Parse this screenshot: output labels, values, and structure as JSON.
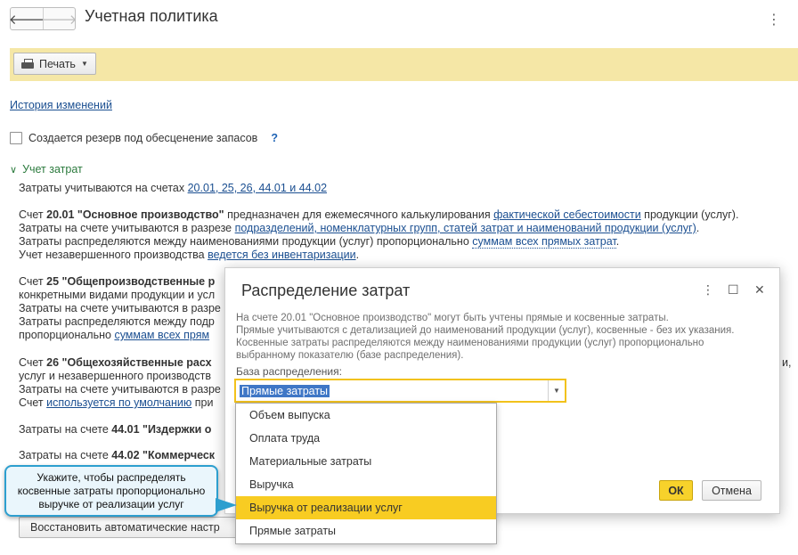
{
  "window": {
    "title": "Учетная политика",
    "back_glyph": "🡐",
    "forward_glyph": "🡒",
    "more_glyph": "⋮"
  },
  "toolbar": {
    "print_label": "Печать"
  },
  "history_link": "История изменений",
  "reserve_checkbox": {
    "label": "Создается резерв под обесценение запасов",
    "help": "?",
    "checked": false
  },
  "cost_section": {
    "title": "Учет затрат",
    "accounts_text": "Затраты учитываются на счетах",
    "accounts_link": "20.01, 25, 26, 44.01 и 44.02",
    "acc2001": {
      "pre": "Счет ",
      "bold": "20.01 \"Основное производство\"",
      "mid": " предназначен для ежемесячного калькулирования ",
      "link": "фактической себестоимости",
      "post": " продукции (услуг)."
    },
    "acc2001_l2": {
      "pre": "Затраты на счете учитываются в разрезе ",
      "link": "подразделений, номенклатурных групп, статей затрат и наименований продукции (услуг)",
      "post": "."
    },
    "acc2001_l3": {
      "pre": "Затраты распределяются между наименованиями продукции (услуг) пропорционально ",
      "link": "суммам всех прямых затрат",
      "post": "."
    },
    "acc2001_l4": {
      "pre": "Учет незавершенного производства ",
      "link": "ведется без инвентаризации",
      "post": "."
    },
    "acc25_l1": {
      "pre": "Счет ",
      "bold": "25 \"Общепроизводственные р"
    },
    "acc25_l2": "конкретными видами продукции и усл",
    "acc25_l3": "Затраты на счете учитываются в разре",
    "acc25_l4": "Затраты распределяются между подр",
    "acc25_l5": {
      "pre": "пропорционально ",
      "link": "суммам всех прям"
    },
    "acc26_l1": {
      "pre": "Счет ",
      "bold": "26 \"Общехозяйственные расх",
      "tail": "и,"
    },
    "acc26_l2": "услуг и незавершенного производств",
    "acc26_l3": "Затраты на счете учитываются в разре",
    "acc26_l4": {
      "pre": "Счет ",
      "link": "используется по умолчанию",
      "post": " при"
    },
    "acc4401": {
      "pre": "Затраты на счете ",
      "bold": "44.01 \"Издержки о"
    },
    "acc4402": {
      "pre": "Затраты на счете ",
      "bold": "44.02 \"Коммерческ"
    },
    "restore_button": "Восстановить автоматические настр"
  },
  "dialog": {
    "title": "Распределение затрат",
    "menu_glyph": "⋮",
    "maximize_glyph": "☐",
    "close_glyph": "✕",
    "description": [
      "На счете 20.01 \"Основное производство\" могут быть учтены прямые и косвенные затраты.",
      "Прямые учитываются с детализацией до наименований продукции (услуг), косвенные - без их указания.",
      "Косвенные затраты распределяются между наименованиями продукции (услуг) пропорционально",
      "выбранному показателю (базе распределения)."
    ],
    "base_label": "База распределения:",
    "base_value": "Прямые затраты",
    "ok": "ОК",
    "cancel": "Отмена"
  },
  "dropdown": {
    "options": [
      "Объем выпуска",
      "Оплата труда",
      "Материальные затраты",
      "Выручка",
      "Выручка от реализации услуг",
      "Прямые затраты"
    ],
    "highlighted": "Выручка от реализации услуг"
  },
  "callout": {
    "lines": [
      "Укажите, чтобы распределять",
      "косвенные затраты пропорционально",
      "выручке от реализации услуг"
    ]
  },
  "colors": {
    "toolbar": "#f5e7a6",
    "accent": "#f8cc22",
    "link": "#1b4f91",
    "callout_border": "#2d9fcf",
    "section": "#2b7a3d"
  }
}
